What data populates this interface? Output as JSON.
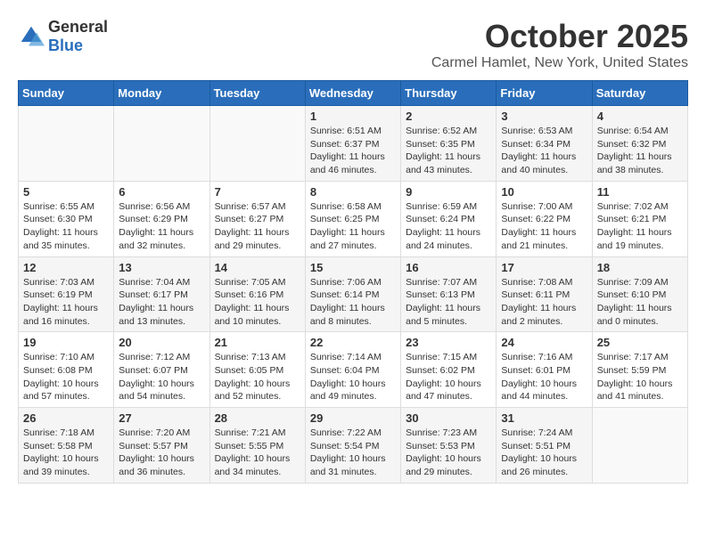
{
  "logo": {
    "general": "General",
    "blue": "Blue"
  },
  "header": {
    "month": "October 2025",
    "location": "Carmel Hamlet, New York, United States"
  },
  "days_of_week": [
    "Sunday",
    "Monday",
    "Tuesday",
    "Wednesday",
    "Thursday",
    "Friday",
    "Saturday"
  ],
  "weeks": [
    [
      {
        "day": "",
        "info": ""
      },
      {
        "day": "",
        "info": ""
      },
      {
        "day": "",
        "info": ""
      },
      {
        "day": "1",
        "info": "Sunrise: 6:51 AM\nSunset: 6:37 PM\nDaylight: 11 hours and 46 minutes."
      },
      {
        "day": "2",
        "info": "Sunrise: 6:52 AM\nSunset: 6:35 PM\nDaylight: 11 hours and 43 minutes."
      },
      {
        "day": "3",
        "info": "Sunrise: 6:53 AM\nSunset: 6:34 PM\nDaylight: 11 hours and 40 minutes."
      },
      {
        "day": "4",
        "info": "Sunrise: 6:54 AM\nSunset: 6:32 PM\nDaylight: 11 hours and 38 minutes."
      }
    ],
    [
      {
        "day": "5",
        "info": "Sunrise: 6:55 AM\nSunset: 6:30 PM\nDaylight: 11 hours and 35 minutes."
      },
      {
        "day": "6",
        "info": "Sunrise: 6:56 AM\nSunset: 6:29 PM\nDaylight: 11 hours and 32 minutes."
      },
      {
        "day": "7",
        "info": "Sunrise: 6:57 AM\nSunset: 6:27 PM\nDaylight: 11 hours and 29 minutes."
      },
      {
        "day": "8",
        "info": "Sunrise: 6:58 AM\nSunset: 6:25 PM\nDaylight: 11 hours and 27 minutes."
      },
      {
        "day": "9",
        "info": "Sunrise: 6:59 AM\nSunset: 6:24 PM\nDaylight: 11 hours and 24 minutes."
      },
      {
        "day": "10",
        "info": "Sunrise: 7:00 AM\nSunset: 6:22 PM\nDaylight: 11 hours and 21 minutes."
      },
      {
        "day": "11",
        "info": "Sunrise: 7:02 AM\nSunset: 6:21 PM\nDaylight: 11 hours and 19 minutes."
      }
    ],
    [
      {
        "day": "12",
        "info": "Sunrise: 7:03 AM\nSunset: 6:19 PM\nDaylight: 11 hours and 16 minutes."
      },
      {
        "day": "13",
        "info": "Sunrise: 7:04 AM\nSunset: 6:17 PM\nDaylight: 11 hours and 13 minutes."
      },
      {
        "day": "14",
        "info": "Sunrise: 7:05 AM\nSunset: 6:16 PM\nDaylight: 11 hours and 10 minutes."
      },
      {
        "day": "15",
        "info": "Sunrise: 7:06 AM\nSunset: 6:14 PM\nDaylight: 11 hours and 8 minutes."
      },
      {
        "day": "16",
        "info": "Sunrise: 7:07 AM\nSunset: 6:13 PM\nDaylight: 11 hours and 5 minutes."
      },
      {
        "day": "17",
        "info": "Sunrise: 7:08 AM\nSunset: 6:11 PM\nDaylight: 11 hours and 2 minutes."
      },
      {
        "day": "18",
        "info": "Sunrise: 7:09 AM\nSunset: 6:10 PM\nDaylight: 11 hours and 0 minutes."
      }
    ],
    [
      {
        "day": "19",
        "info": "Sunrise: 7:10 AM\nSunset: 6:08 PM\nDaylight: 10 hours and 57 minutes."
      },
      {
        "day": "20",
        "info": "Sunrise: 7:12 AM\nSunset: 6:07 PM\nDaylight: 10 hours and 54 minutes."
      },
      {
        "day": "21",
        "info": "Sunrise: 7:13 AM\nSunset: 6:05 PM\nDaylight: 10 hours and 52 minutes."
      },
      {
        "day": "22",
        "info": "Sunrise: 7:14 AM\nSunset: 6:04 PM\nDaylight: 10 hours and 49 minutes."
      },
      {
        "day": "23",
        "info": "Sunrise: 7:15 AM\nSunset: 6:02 PM\nDaylight: 10 hours and 47 minutes."
      },
      {
        "day": "24",
        "info": "Sunrise: 7:16 AM\nSunset: 6:01 PM\nDaylight: 10 hours and 44 minutes."
      },
      {
        "day": "25",
        "info": "Sunrise: 7:17 AM\nSunset: 5:59 PM\nDaylight: 10 hours and 41 minutes."
      }
    ],
    [
      {
        "day": "26",
        "info": "Sunrise: 7:18 AM\nSunset: 5:58 PM\nDaylight: 10 hours and 39 minutes."
      },
      {
        "day": "27",
        "info": "Sunrise: 7:20 AM\nSunset: 5:57 PM\nDaylight: 10 hours and 36 minutes."
      },
      {
        "day": "28",
        "info": "Sunrise: 7:21 AM\nSunset: 5:55 PM\nDaylight: 10 hours and 34 minutes."
      },
      {
        "day": "29",
        "info": "Sunrise: 7:22 AM\nSunset: 5:54 PM\nDaylight: 10 hours and 31 minutes."
      },
      {
        "day": "30",
        "info": "Sunrise: 7:23 AM\nSunset: 5:53 PM\nDaylight: 10 hours and 29 minutes."
      },
      {
        "day": "31",
        "info": "Sunrise: 7:24 AM\nSunset: 5:51 PM\nDaylight: 10 hours and 26 minutes."
      },
      {
        "day": "",
        "info": ""
      }
    ]
  ]
}
